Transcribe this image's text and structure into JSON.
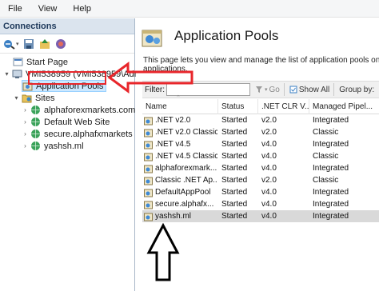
{
  "menubar": {
    "items": [
      "File",
      "View",
      "Help"
    ]
  },
  "connections": {
    "header": "Connections",
    "tree": [
      {
        "label": "Start Page",
        "level": 1,
        "expander": "",
        "icon": "start-page-icon"
      },
      {
        "label": "VMI538959 (VMI538959\\Admi",
        "level": 0,
        "expander": "▾",
        "icon": "server-icon"
      },
      {
        "label": "Application Pools",
        "level": 1,
        "expander": "",
        "icon": "app-pools-icon",
        "selected": true
      },
      {
        "label": "Sites",
        "level": 1,
        "expander": "▾",
        "icon": "sites-folder-icon"
      },
      {
        "label": "alphaforexmarkets.com",
        "level": 2,
        "expander": "›",
        "icon": "globe-icon"
      },
      {
        "label": "Default Web Site",
        "level": 2,
        "expander": "›",
        "icon": "globe-icon"
      },
      {
        "label": "secure.alphafxmarkets",
        "level": 2,
        "expander": "›",
        "icon": "globe-icon"
      },
      {
        "label": "yashsh.ml",
        "level": 2,
        "expander": "›",
        "icon": "globe-icon"
      }
    ]
  },
  "main": {
    "title": "Application Pools",
    "description_line1": "This page lets you view and manage the list of application pools on t",
    "description_line2": "applications.",
    "filterbar": {
      "filter_label": "Filter:",
      "go_label": "Go",
      "show_all_label": "Show All",
      "group_by_label": "Group by:"
    },
    "columns": [
      "Name",
      "Status",
      ".NET CLR V...",
      "Managed Pipel..."
    ],
    "rows": [
      {
        "name": ".NET v2.0",
        "status": "Started",
        "clr": "v2.0",
        "pipeline": "Integrated"
      },
      {
        "name": ".NET v2.0 Classic",
        "status": "Started",
        "clr": "v2.0",
        "pipeline": "Classic"
      },
      {
        "name": ".NET v4.5",
        "status": "Started",
        "clr": "v4.0",
        "pipeline": "Integrated"
      },
      {
        "name": ".NET v4.5 Classic",
        "status": "Started",
        "clr": "v4.0",
        "pipeline": "Classic"
      },
      {
        "name": "alphaforexmark...",
        "status": "Started",
        "clr": "v4.0",
        "pipeline": "Integrated"
      },
      {
        "name": "Classic .NET Ap...",
        "status": "Started",
        "clr": "v2.0",
        "pipeline": "Classic"
      },
      {
        "name": "DefaultAppPool",
        "status": "Started",
        "clr": "v4.0",
        "pipeline": "Integrated"
      },
      {
        "name": "secure.alphafx...",
        "status": "Started",
        "clr": "v4.0",
        "pipeline": "Integrated"
      },
      {
        "name": "yashsh.ml",
        "status": "Started",
        "clr": "v4.0",
        "pipeline": "Integrated",
        "selected": true
      }
    ]
  },
  "colors": {
    "annotation": "#e8262b",
    "selection": "#cce8ff",
    "header": "#dbe4ee",
    "arrow": "#000000"
  }
}
